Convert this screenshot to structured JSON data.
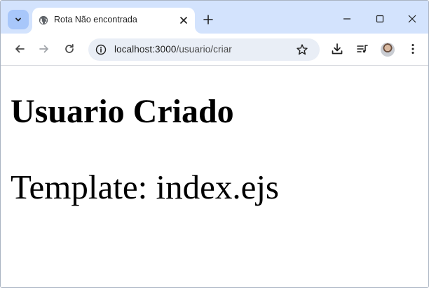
{
  "tab": {
    "title": "Rota Não encontrada"
  },
  "address_bar": {
    "host": "localhost:3000",
    "path": "/usuario/criar"
  },
  "page": {
    "heading": "Usuario Criado",
    "paragraph": "Template: index.ejs"
  },
  "icons": {
    "tab_search": "chevron-down-icon",
    "favicon": "globe-icon",
    "tab_close": "close-icon",
    "new_tab": "plus-icon",
    "minimize": "minimize-icon",
    "maximize": "maximize-icon",
    "close": "close-icon",
    "back": "arrow-left-icon",
    "forward": "arrow-right-icon",
    "reload": "reload-icon",
    "site_info": "info-icon",
    "bookmark": "star-icon",
    "download": "download-icon",
    "media": "media-queue-icon",
    "profile": "avatar",
    "menu": "kebab-menu-icon"
  },
  "colors": {
    "tabstrip": "#d3e3fd",
    "tab_search_bg": "#a8c7fa",
    "omnibox_bg": "#e9eef6"
  }
}
